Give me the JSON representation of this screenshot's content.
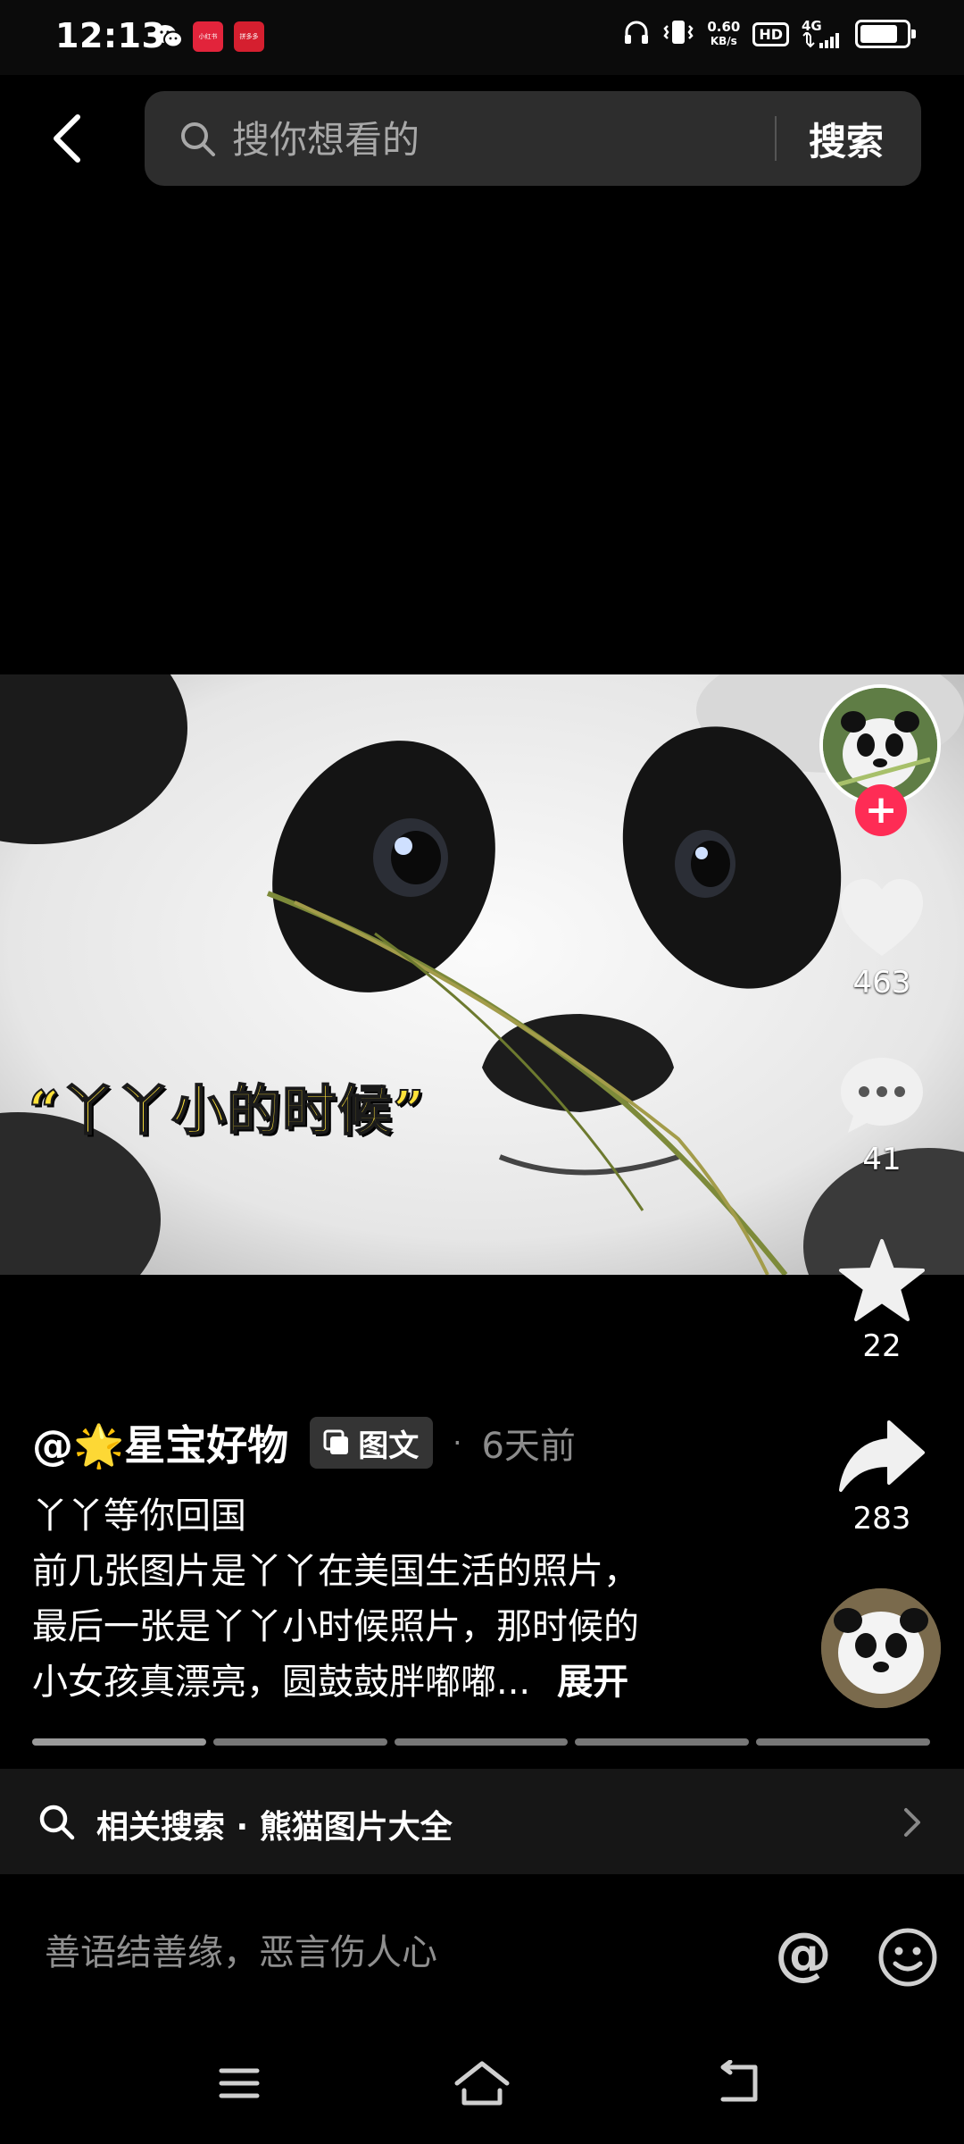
{
  "status_bar": {
    "time": "12:13",
    "net_speed_value": "0.60",
    "net_speed_unit": "KB/s",
    "hd": "HD",
    "network": "4G",
    "app_badge_1": "小红书",
    "app_badge_2": "拼多多"
  },
  "search": {
    "placeholder": "搜你想看的",
    "button_label": "搜索"
  },
  "photo": {
    "caption": "“丫丫小的时候”"
  },
  "actions": {
    "follow_symbol": "+",
    "likes": "463",
    "comments": "41",
    "favorites": "22",
    "shares": "283"
  },
  "post": {
    "author": "@🌟星宝好物",
    "type_label": "图文",
    "dot": "·",
    "time": "6天前",
    "lines": [
      "丫丫等你回国",
      "前几张图片是丫丫在美国生活的照片，",
      "最后一张是丫丫小时候照片，那时候的",
      "小女孩真漂亮，圆鼓鼓胖嘟嘟..."
    ],
    "expand_label": "展开"
  },
  "carousel": {
    "total": 5,
    "current": 1
  },
  "related": {
    "label": "相关搜索 · 熊猫图片大全"
  },
  "comment": {
    "placeholder": "善语结善缘，恶言伤人心",
    "at_symbol": "@"
  },
  "colors": {
    "accent": "#fe2c55",
    "caption_yellow": "#ffe23a",
    "secondary_text": "#8c8c8c"
  }
}
